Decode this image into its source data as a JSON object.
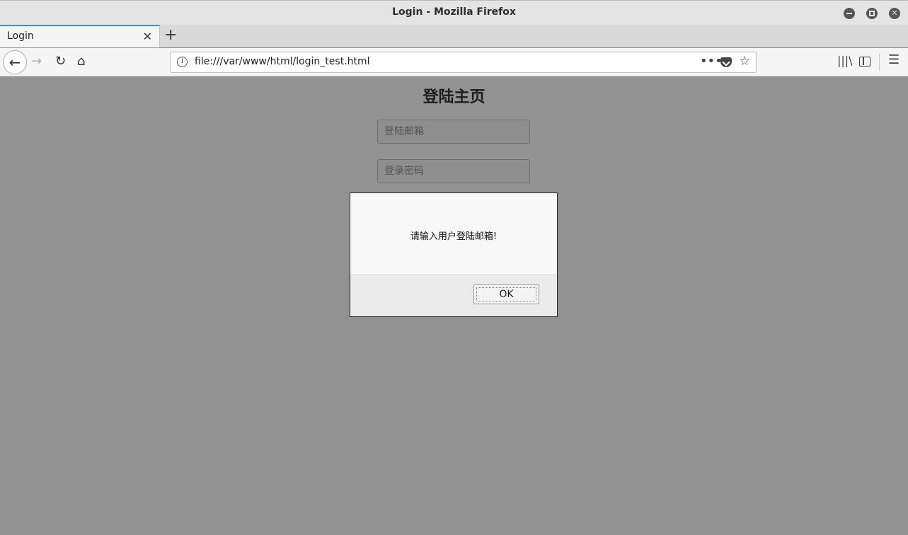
{
  "window": {
    "title": "Login - Mozilla Firefox"
  },
  "tabs": [
    {
      "label": "Login",
      "close": "✕"
    }
  ],
  "newtab": {
    "label": "+"
  },
  "nav": {
    "back": "←",
    "forward": "→",
    "reload": "↻",
    "home": "⌂",
    "url": "file:///var/www/html/login_test.html",
    "info": "i",
    "more": "•••",
    "star": "☆",
    "library": "|||\\",
    "menu": "☰"
  },
  "page": {
    "heading": "登陆主页",
    "email_placeholder": "登陆邮箱",
    "password_placeholder": "登录密码"
  },
  "dialog": {
    "message": "请输入用户登陆邮箱!",
    "ok_label": "OK"
  }
}
